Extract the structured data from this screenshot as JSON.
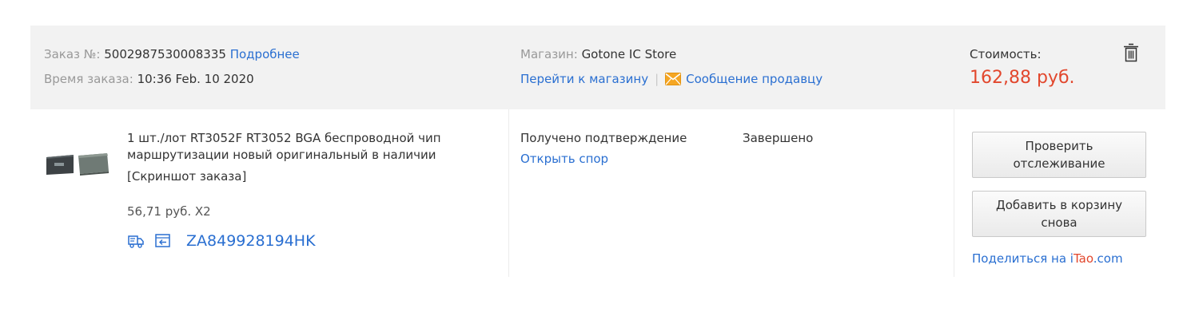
{
  "header": {
    "order_label": "Заказ №: ",
    "order_number": "5002987530008335",
    "details_link": "Подробнее",
    "time_label": "Время заказа: ",
    "time_value": "10:36 Feb. 10 2020",
    "store_label": "Магазин: ",
    "store_name": "Gotone IC Store",
    "goto_store_link": "Перейти к магазину",
    "separator": "|",
    "message_seller_link": "Сообщение продавцу",
    "cost_label": "Стоимость:",
    "cost_value": "162,88 руб.",
    "icons": {
      "mail": "mail-icon",
      "delete": "trash-icon"
    }
  },
  "item": {
    "title": "1 шт./лот RT3052F RT3052 BGA беспроводной чип маршрутизации новый оригинальный в наличии",
    "snapshot_link": "[Скриншот заказа]",
    "price_qty": "56,71 руб. X2",
    "tracking_number": "ZA849928194HK",
    "icons": [
      "delivery-truck-icon",
      "return-icon"
    ]
  },
  "status": {
    "confirmation": "Получено подтверждение",
    "dispute_link": "Открыть спор",
    "state": "Завершено"
  },
  "actions": {
    "check_tracking": "Проверить отслеживание",
    "add_to_cart_again": "Добавить в корзину снова",
    "share_prefix": "Поделиться на ",
    "share_i": "i",
    "share_tao": "Tao",
    "share_suffix": ".com"
  },
  "colors": {
    "link": "#2a6fd1",
    "price": "#e2472d",
    "header_bg": "#f2f2f2",
    "mail_icon": "#f5a623"
  }
}
